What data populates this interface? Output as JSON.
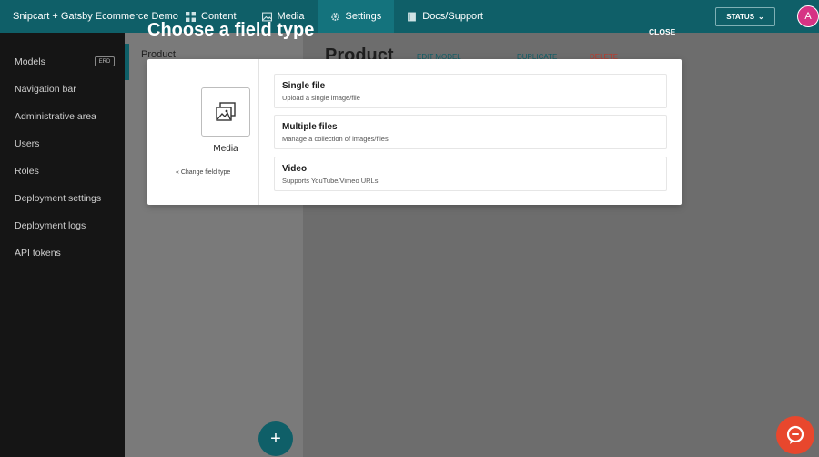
{
  "topbar": {
    "project_name": "Snipcart + Gatsby Ecommerce Demo",
    "tabs": [
      {
        "label": "Content",
        "icon": "grid-icon"
      },
      {
        "label": "Media",
        "icon": "image-icon"
      },
      {
        "label": "Settings",
        "icon": "gear-icon",
        "active": true
      },
      {
        "label": "Docs/Support",
        "icon": "book-icon"
      }
    ],
    "status_label": "STATUS",
    "avatar_initial": "A"
  },
  "sidebar": {
    "items": [
      {
        "label": "Models",
        "badge": "ERD"
      },
      {
        "label": "Navigation bar"
      },
      {
        "label": "Administrative area"
      },
      {
        "label": "Users"
      },
      {
        "label": "Roles"
      },
      {
        "label": "Deployment settings"
      },
      {
        "label": "Deployment logs"
      },
      {
        "label": "API tokens"
      }
    ]
  },
  "panel2": {
    "title": "Product",
    "add_label": "+"
  },
  "main": {
    "title": "Product",
    "links": {
      "edit_model": "EDIT MODEL",
      "duplicate": "DUPLICATE",
      "delete": "DELETE"
    }
  },
  "modal": {
    "heading": "Choose a field type",
    "close_label": "CLOSE",
    "category_label": "Media",
    "change_type_label": "« Change field type",
    "options": [
      {
        "title": "Single file",
        "description": "Upload a single image/file"
      },
      {
        "title": "Multiple files",
        "description": "Manage a collection of images/files"
      },
      {
        "title": "Video",
        "description": "Supports YouTube/Vimeo URLs"
      }
    ]
  },
  "colors": {
    "brand": "#0f5f68",
    "chat": "#e8472d",
    "avatar": "#d63384"
  }
}
